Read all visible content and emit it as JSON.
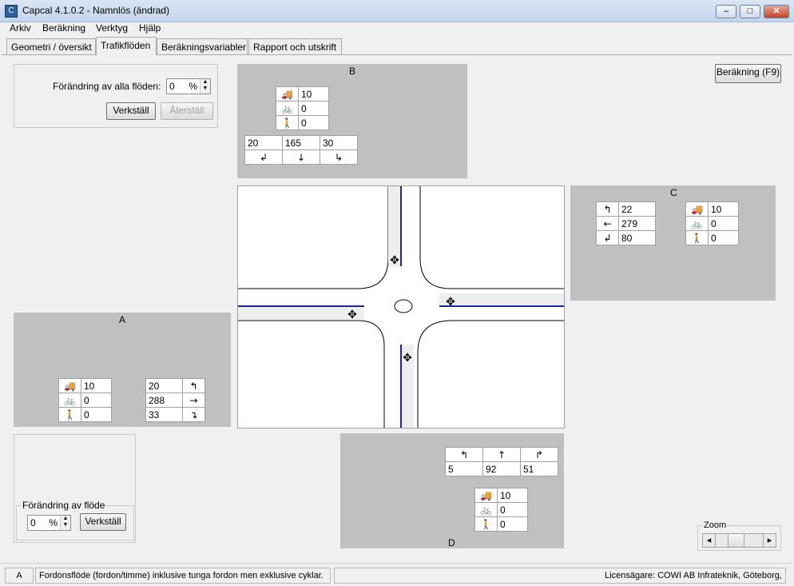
{
  "window": {
    "title": "Capcal 4.1.0.2 - Namnlös (ändrad)",
    "minimize": "–",
    "maximize": "□",
    "close": "✕"
  },
  "menu": [
    "Arkiv",
    "Beräkning",
    "Verktyg",
    "Hjälp"
  ],
  "tabs": [
    "Geometri / översikt",
    "Trafikflöden",
    "Beräkningsvariabler",
    "Rapport och utskrift"
  ],
  "active_tab": "Trafikflöden",
  "all_flows": {
    "label": "Förändring av alla flöden:",
    "value": "0",
    "unit": "%",
    "apply": "Verkställ",
    "reset": "Återställ"
  },
  "calc_button": "Beräkning (F9)",
  "approaches": {
    "A": {
      "name": "A",
      "vehicles": {
        "heavy": "10",
        "bike": "0",
        "ped": "0"
      },
      "turns": [
        {
          "value": "20",
          "arrow": "↰"
        },
        {
          "value": "288",
          "arrow": "→"
        },
        {
          "value": "33",
          "arrow": "↴"
        }
      ]
    },
    "B": {
      "name": "B",
      "vehicles": {
        "heavy": "10",
        "bike": "0",
        "ped": "0"
      },
      "turns": [
        {
          "value": "20",
          "arrow": "↲"
        },
        {
          "value": "165",
          "arrow": "↓"
        },
        {
          "value": "30",
          "arrow": "↳"
        }
      ]
    },
    "C": {
      "name": "C",
      "vehicles": {
        "heavy": "10",
        "bike": "0",
        "ped": "0"
      },
      "turns": [
        {
          "value": "22",
          "arrow": "↰"
        },
        {
          "value": "279",
          "arrow": "←"
        },
        {
          "value": "80",
          "arrow": "↲"
        }
      ]
    },
    "D": {
      "name": "D",
      "vehicles": {
        "heavy": "10",
        "bike": "0",
        "ped": "0"
      },
      "turns": [
        {
          "value": "5",
          "arrow": "↰"
        },
        {
          "value": "92",
          "arrow": "↑"
        },
        {
          "value": "51",
          "arrow": "↱"
        }
      ]
    }
  },
  "flow_change": {
    "legend": "Förändring av flöde",
    "value": "0",
    "unit": "%",
    "apply": "Verkställ"
  },
  "zoom": {
    "legend": "Zoom",
    "left": "◂",
    "right": "▸"
  },
  "status": {
    "approach": "A",
    "description": "Fordonsflöde (fordon/timme) inklusive tunga fordon men exklusive cyklar.",
    "license": "Licensägare: COWI AB Infrateknik, Göteborg,"
  },
  "icons": {
    "heavy": "truck-icon",
    "bike": "bicycle-icon",
    "ped": "pedestrians-icon"
  }
}
